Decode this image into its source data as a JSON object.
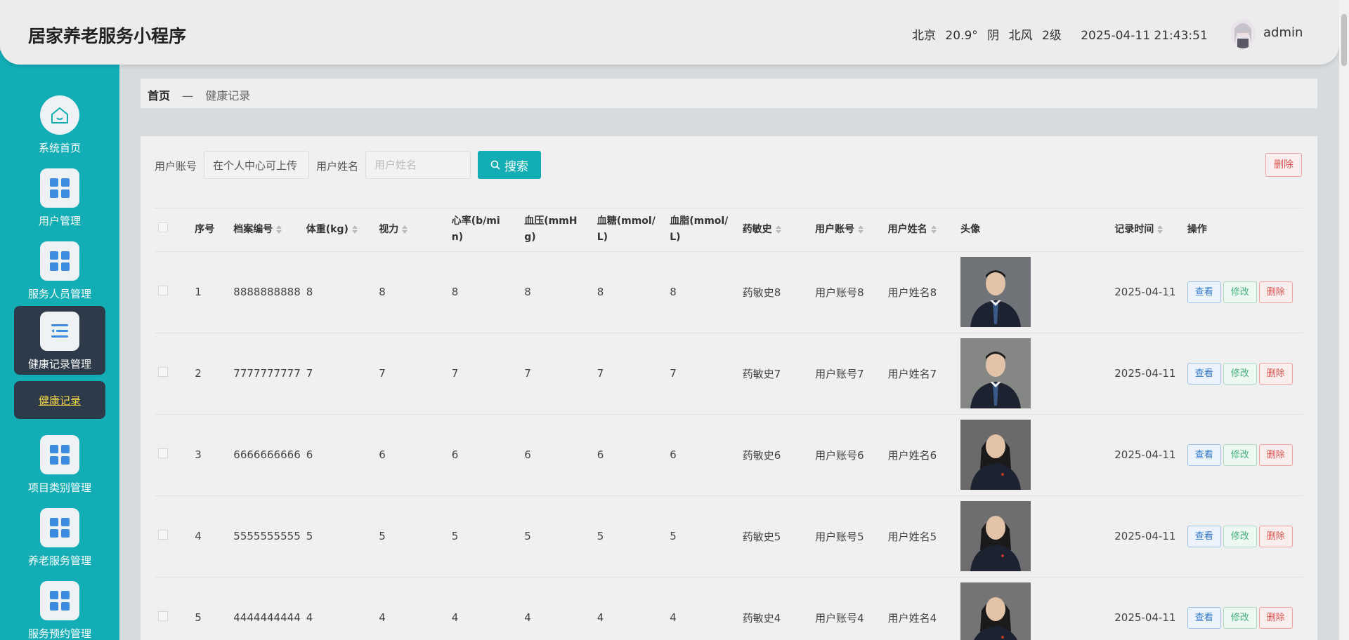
{
  "app": {
    "title": "居家养老服务小程序"
  },
  "header": {
    "city": "北京",
    "temperature": "20.9°",
    "weather": "阴",
    "wind": "北风",
    "wind_level": "2级",
    "datetime": "2025-04-11 21:43:51",
    "username": "admin"
  },
  "sidebar": {
    "items": [
      {
        "label": "系统首页",
        "icon": "home-icon"
      },
      {
        "label": "用户管理",
        "icon": "grid-icon"
      },
      {
        "label": "服务人员管理",
        "icon": "grid-icon"
      },
      {
        "label": "健康记录管理",
        "icon": "list-icon"
      },
      {
        "label": "项目类别管理",
        "icon": "grid-icon"
      },
      {
        "label": "养老服务管理",
        "icon": "grid-icon"
      },
      {
        "label": "服务预约管理",
        "icon": "grid-icon"
      }
    ],
    "sub_item": "健康记录"
  },
  "breadcrumb": {
    "home": "首页",
    "sep": "—",
    "current": "健康记录"
  },
  "search": {
    "account_label": "用户账号",
    "account_value": "在个人中心可上传",
    "name_label": "用户姓名",
    "name_placeholder": "用户姓名",
    "button": "搜索"
  },
  "delete_label": "删除",
  "table": {
    "headers": {
      "index": "序号",
      "file_no": "档案编号",
      "weight": "体重(kg)",
      "vision": "视力",
      "heart_rate": "心率(b/min)",
      "blood_pressure": "血压(mmHg)",
      "blood_sugar": "血糖(mmol/L)",
      "blood_lipid": "血脂(mmol/L)",
      "allergy": "药敏史",
      "account": "用户账号",
      "name": "用户姓名",
      "avatar": "头像",
      "time": "记录时间",
      "ops": "操作"
    },
    "actions": {
      "view": "查看",
      "edit": "修改",
      "delete": "删除"
    },
    "rows": [
      {
        "index": "1",
        "file_no": "8888888888",
        "weight": "8",
        "vision": "8",
        "heart_rate": "8",
        "blood_pressure": "8",
        "blood_sugar": "8",
        "blood_lipid": "8",
        "allergy": "药敏史8",
        "account": "用户账号8",
        "name": "用户姓名8",
        "time": "2025-04-11"
      },
      {
        "index": "2",
        "file_no": "7777777777",
        "weight": "7",
        "vision": "7",
        "heart_rate": "7",
        "blood_pressure": "7",
        "blood_sugar": "7",
        "blood_lipid": "7",
        "allergy": "药敏史7",
        "account": "用户账号7",
        "name": "用户姓名7",
        "time": "2025-04-11"
      },
      {
        "index": "3",
        "file_no": "6666666666",
        "weight": "6",
        "vision": "6",
        "heart_rate": "6",
        "blood_pressure": "6",
        "blood_sugar": "6",
        "blood_lipid": "6",
        "allergy": "药敏史6",
        "account": "用户账号6",
        "name": "用户姓名6",
        "time": "2025-04-11"
      },
      {
        "index": "4",
        "file_no": "5555555555",
        "weight": "5",
        "vision": "5",
        "heart_rate": "5",
        "blood_pressure": "5",
        "blood_sugar": "5",
        "blood_lipid": "5",
        "allergy": "药敏史5",
        "account": "用户账号5",
        "name": "用户姓名5",
        "time": "2025-04-11"
      },
      {
        "index": "5",
        "file_no": "4444444444",
        "weight": "4",
        "vision": "4",
        "heart_rate": "4",
        "blood_pressure": "4",
        "blood_sugar": "4",
        "blood_lipid": "4",
        "allergy": "药敏史4",
        "account": "用户账号4",
        "name": "用户姓名4",
        "time": "2025-04-11"
      }
    ]
  },
  "colors": {
    "accent": "#13adb6",
    "sidebar_active": "#2c3a49",
    "submenu_text": "#f5d547"
  }
}
